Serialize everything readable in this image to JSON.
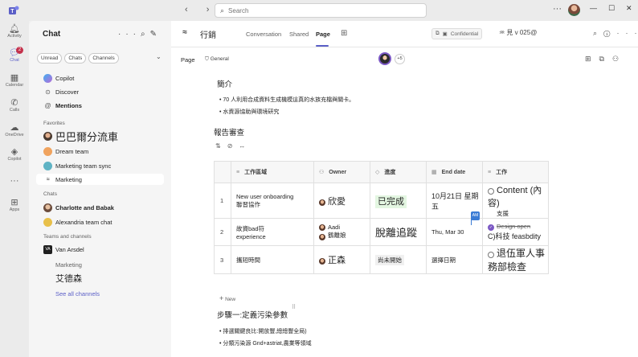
{
  "search": {
    "placeholder": "Search"
  },
  "rail": [
    {
      "label": "Activity",
      "icon": "bell-icon"
    },
    {
      "label": "Chat",
      "icon": "chat-icon",
      "badge": "2"
    },
    {
      "label": "Calendar",
      "icon": "calendar-icon"
    },
    {
      "label": "Calls",
      "icon": "phone-icon"
    },
    {
      "label": "OneDrive",
      "icon": "cloud-icon"
    },
    {
      "label": "Copilot",
      "icon": "copilot-icon"
    },
    {
      "label": "Apps",
      "icon": "apps-icon"
    }
  ],
  "chatpanel": {
    "title": "Chat",
    "filters": [
      "Unread",
      "Chats",
      "Channels"
    ],
    "top_items": [
      "Copilot",
      "Discover",
      "Mentions"
    ],
    "favorites_label": "Favorites",
    "favorites": [
      "巴巴爾分流車",
      "Dream team",
      "Marketing team sync",
      "Marketing"
    ],
    "chats_label": "Chats",
    "chats": [
      "Charlotte and Babak",
      "Alexandria team chat"
    ],
    "teams_label": "Teams and channels",
    "team_name": "Van Arsdel",
    "channels": [
      "Marketing",
      "艾德森",
      "See all channels"
    ]
  },
  "header": {
    "channel_name": "行銷",
    "tabs": [
      "Conversation",
      "Shared",
      "Page"
    ],
    "confidential": "Confidential",
    "sensitivity": "見 v 025@"
  },
  "pagebar": {
    "page_label": "Page",
    "general": "General",
    "more_count": "+5"
  },
  "doc": {
    "intro_heading": "簡介",
    "intro_bullets": [
      "70 人利用合成資料生成機模這真的水族充檔與關卡。",
      "水資源協助與環境研究"
    ],
    "review_heading": "報告審查",
    "table": {
      "headers": [
        "工作區域",
        "Owner",
        "進度",
        "End date",
        "工作"
      ],
      "rows": [
        {
          "num": "1",
          "area": "New user onboarding",
          "area2": "聯習協作",
          "owner": "欣愛",
          "status": "已完成",
          "end": "10月21日 星期五",
          "task": "Content (內容)",
          "task2": "支援"
        },
        {
          "num": "2",
          "area": "故資bad符",
          "area2": "experience",
          "owner": "Aadi",
          "owner2": "鶴離娘",
          "status": "脫離追蹤",
          "end": "Thu, Mar 30",
          "task": "Design open",
          "task2": "C)科技 feasbdity"
        },
        {
          "num": "3",
          "area": "攜短時間",
          "owner": "正森",
          "status": "尚未開始",
          "end": "選擇日期",
          "task": "退伍軍人事務部檢查"
        }
      ],
      "new_label": "New",
      "cursor_initials": "AM"
    },
    "step_heading": "步驟一:定義污染參數",
    "step_bullets": [
      "排選關鍵良比:開放豐,總總豐全局)",
      "分類污染源 Gnd+astriat,農業等領域"
    ]
  }
}
